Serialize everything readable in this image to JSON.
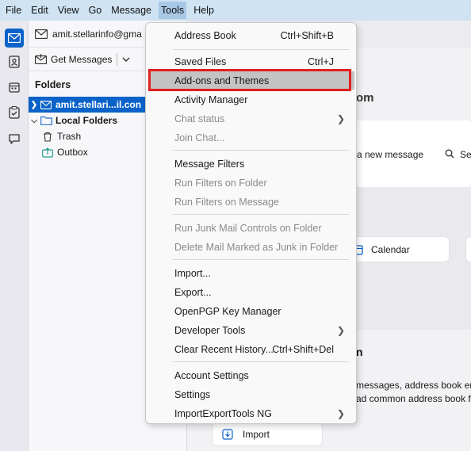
{
  "menubar": {
    "items": [
      "File",
      "Edit",
      "View",
      "Go",
      "Message",
      "Tools",
      "Help"
    ]
  },
  "account_bar": {
    "email": "amit.stellarinfo@gma"
  },
  "toolbar": {
    "get_messages": "Get Messages"
  },
  "folder_pane": {
    "heading": "Folders",
    "account": "amit.stellari...il.con",
    "local_folders": "Local Folders",
    "trash": "Trash",
    "outbox": "Outbox"
  },
  "content": {
    "account_suffix": "om",
    "new_message": "a new message",
    "search_short": "Se",
    "calendar": "Calendar",
    "section_fragment": "n",
    "import_line1": "messages, address book entr",
    "import_line2": "ad common address book fo",
    "import_button": "Import"
  },
  "tools_menu": {
    "address_book": "Address Book",
    "address_book_shortcut": "Ctrl+Shift+B",
    "saved_files": "Saved Files",
    "saved_files_shortcut": "Ctrl+J",
    "addons": "Add-ons and Themes",
    "activity_manager": "Activity Manager",
    "chat_status": "Chat status",
    "join_chat": "Join Chat...",
    "message_filters": "Message Filters",
    "run_filters_folder": "Run Filters on Folder",
    "run_filters_message": "Run Filters on Message",
    "run_junk": "Run Junk Mail Controls on Folder",
    "delete_junk": "Delete Mail Marked as Junk in Folder",
    "import": "Import...",
    "export": "Export...",
    "openpgp": "OpenPGP Key Manager",
    "developer_tools": "Developer Tools",
    "clear_history": "Clear Recent History...",
    "clear_history_shortcut": "Ctrl+Shift+Del",
    "account_settings": "Account Settings",
    "settings": "Settings",
    "importexport": "ImportExportTools NG"
  },
  "colors": {
    "accent": "#0b63c9",
    "highlight_box": "#e0201c",
    "menu_hover": "#c3c3c3"
  }
}
